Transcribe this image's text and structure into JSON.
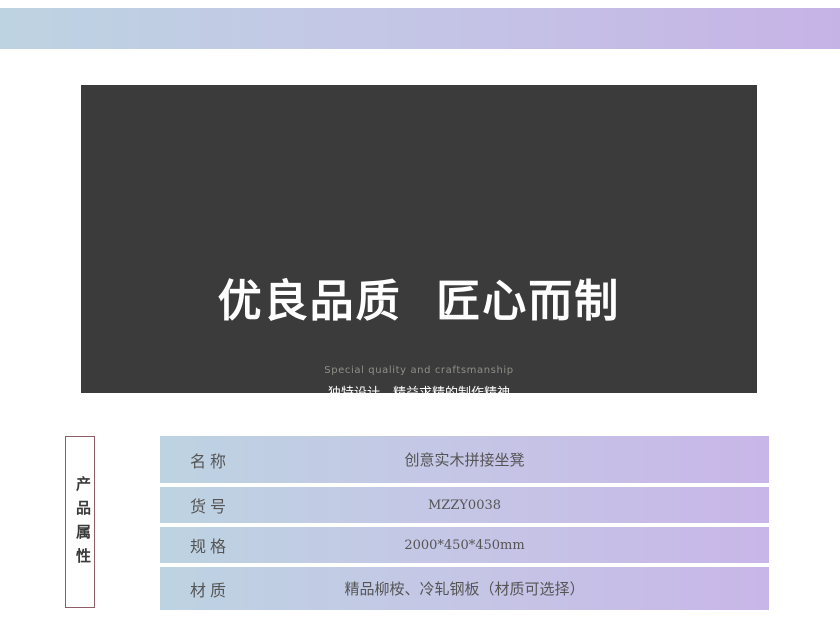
{
  "hero": {
    "title": "优良品质  匠心而制",
    "subtitle_en": "Special quality and craftsmanship",
    "subtitle_cn": "独特设计、精益求精的制作精神"
  },
  "side_tag": {
    "label": "产品属性"
  },
  "specs": [
    {
      "label": "名称",
      "value": "创意实木拼接坐凳"
    },
    {
      "label": "货号",
      "value": "MZZY0038"
    },
    {
      "label": "规格",
      "value": "2000*450*450mm"
    },
    {
      "label": "材质",
      "value": "精品柳桉、冷轧钢板（材质可选择）"
    }
  ],
  "colors": {
    "band_start": "#bdd3e2",
    "band_end": "#c6b3e6",
    "hero_bg": "#3b3b3b",
    "tag_border": "#8e5c66"
  }
}
